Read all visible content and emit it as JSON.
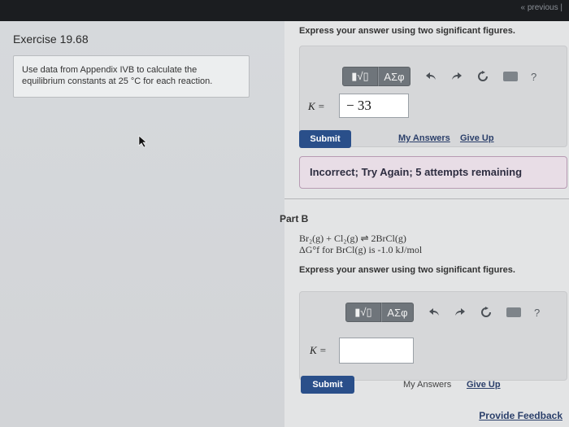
{
  "header": {
    "previous_label": "« previous |"
  },
  "exercise": {
    "title": "Exercise 19.68",
    "instructions_line1": "Use data from Appendix IVB to calculate the",
    "instructions_line2": "equilibrium constants at 25 °C for each reaction."
  },
  "part_a": {
    "prompt": "Express your answer using two significant figures.",
    "toolbar": {
      "template_label": "▮√▯",
      "greek_label": "ΑΣφ",
      "help_label": "?"
    },
    "k_label": "K =",
    "k_value": "− 33",
    "submit_label": "Submit",
    "my_answers_label": "My Answers",
    "give_up_label": "Give Up",
    "feedback_message": "Incorrect; Try Again; 5 attempts remaining"
  },
  "part_b": {
    "label": "Part B",
    "equation": "Br₂(g) + Cl₂(g) ⇌ 2BrCl(g)",
    "delta_g": "ΔG°f for BrCl(g) is -1.0 kJ/mol",
    "prompt": "Express your answer using two significant figures.",
    "toolbar": {
      "template_label": "▮√▯",
      "greek_label": "ΑΣφ",
      "help_label": "?"
    },
    "k_label": "K =",
    "k_value": "",
    "submit_label": "Submit",
    "my_answers_label": "My Answers",
    "give_up_label": "Give Up"
  },
  "footer": {
    "provide_feedback_label": "Provide Feedback"
  }
}
